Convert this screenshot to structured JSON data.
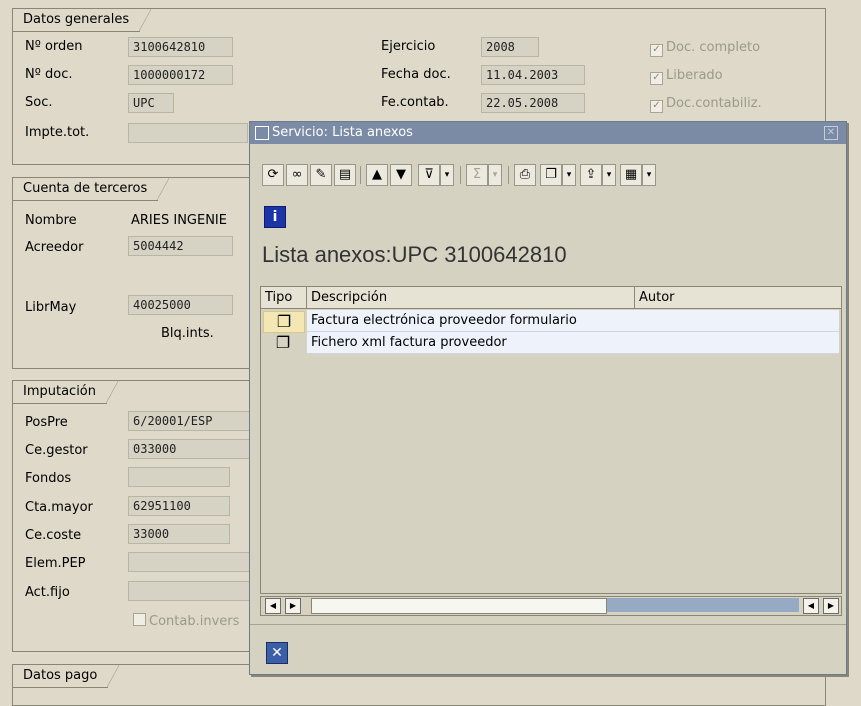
{
  "datos_generales": {
    "title": "Datos generales",
    "n_orden_label": "Nº orden",
    "n_orden": "3100642810",
    "n_doc_label": "Nº doc.",
    "n_doc": "1000000172",
    "soc_label": "Soc.",
    "soc": "UPC",
    "impte_label": "Impte.tot.",
    "impte": "",
    "ejercicio_label": "Ejercicio",
    "ejercicio": "2008",
    "fecha_doc_label": "Fecha doc.",
    "fecha_doc": "11.04.2003",
    "fe_contab_label": "Fe.contab.",
    "fe_contab": "22.05.2008",
    "doc_completo": "Doc. completo",
    "liberado": "Liberado",
    "doc_contabiliz": "Doc.contabiliz."
  },
  "cuenta_terceros": {
    "title": "Cuenta de terceros",
    "nombre_label": "Nombre",
    "nombre": "ARIES INGENIE",
    "acreedor_label": "Acreedor",
    "acreedor": "5004442",
    "librmay_label": "LibrMay",
    "librmay": "40025000",
    "blq_label": "Blq.ints."
  },
  "imputacion": {
    "title": "Imputación",
    "pospre_label": "PosPre",
    "pospre": "6/20001/ESP",
    "cegestor_label": "Ce.gestor",
    "cegestor": "033000",
    "fondos_label": "Fondos",
    "fondos": "",
    "ctamayor_label": "Cta.mayor",
    "ctamayor": "62951100",
    "cecoste_label": "Ce.coste",
    "cecoste": "33000",
    "elempep_label": "Elem.PEP",
    "elempep": "",
    "actfijo_label": "Act.fijo",
    "actfijo": "",
    "contab_label": "Contab.invers"
  },
  "datos_pago": {
    "title": "Datos pago"
  },
  "dialog": {
    "title": "Servicio: Lista anexos",
    "heading": "Lista anexos:UPC 3100642810",
    "columns": {
      "tipo": "Tipo",
      "descripcion": "Descripción",
      "autor": "Autor"
    },
    "rows": [
      {
        "descripcion": "Factura electrónica proveedor formulario"
      },
      {
        "descripcion": "Fichero xml factura proveedor"
      }
    ]
  }
}
